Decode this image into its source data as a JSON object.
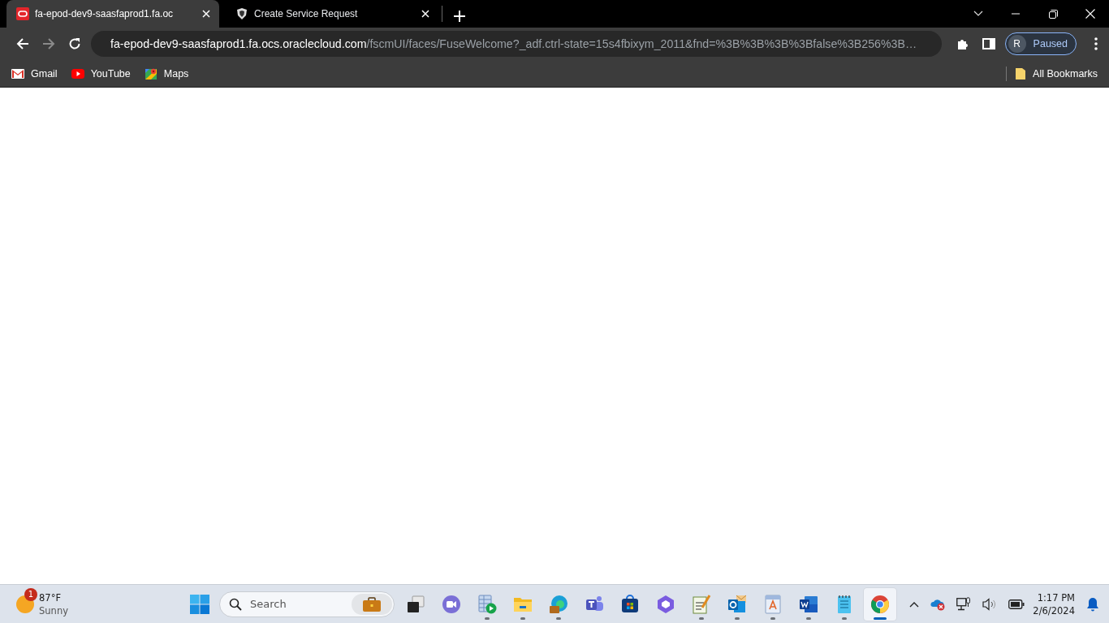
{
  "tabs": [
    {
      "title": "fa-epod-dev9-saasfaprod1.fa.oc",
      "kind": "oracle",
      "selected": true
    },
    {
      "title": "Create Service Request",
      "kind": "shield",
      "selected": false
    }
  ],
  "toolbar": {
    "back": {
      "disabled": false
    },
    "forward": {
      "disabled": true
    },
    "address": {
      "host": "fa-epod-dev9-saasfaprod1.fa.ocs.oraclecloud.com",
      "path": "/fscmUI/faces/FuseWelcome?_adf.ctrl-state=15s4fbixym_2011&fnd=%3B%3B%3B%3Bfalse%3B256%3B…"
    },
    "profile": {
      "initial": "R",
      "status": "Paused"
    }
  },
  "bookmarks": [
    {
      "label": "Gmail",
      "kind": "mail"
    },
    {
      "label": "YouTube",
      "kind": "video"
    },
    {
      "label": "Maps",
      "kind": "map"
    }
  ],
  "all_bookmarks": "All Bookmarks",
  "taskbar": {
    "weather": {
      "badge": "1",
      "temperature": "87°F",
      "condition": "Sunny"
    },
    "search": {
      "placeholder": "Search"
    },
    "apps": [
      {
        "kind": "taskview",
        "running": false,
        "selected": false
      },
      {
        "kind": "camera",
        "running": false,
        "selected": false
      },
      {
        "kind": "tableplay",
        "running": true,
        "selected": false
      },
      {
        "kind": "folder",
        "running": true,
        "selected": false
      },
      {
        "kind": "edge",
        "running": true,
        "selected": false
      },
      {
        "kind": "teams",
        "running": false,
        "selected": false
      },
      {
        "kind": "store",
        "running": false,
        "selected": false
      },
      {
        "kind": "hexagon",
        "running": false,
        "selected": false
      },
      {
        "kind": "notepen",
        "running": true,
        "selected": false
      },
      {
        "kind": "outlook",
        "running": true,
        "selected": false
      },
      {
        "kind": "reader",
        "running": true,
        "selected": false
      },
      {
        "kind": "word",
        "running": true,
        "selected": false
      },
      {
        "kind": "notepad",
        "running": true,
        "selected": false
      },
      {
        "kind": "chrome",
        "running": true,
        "selected": true
      }
    ],
    "time": "1:17 PM",
    "date": "2/6/2024"
  }
}
